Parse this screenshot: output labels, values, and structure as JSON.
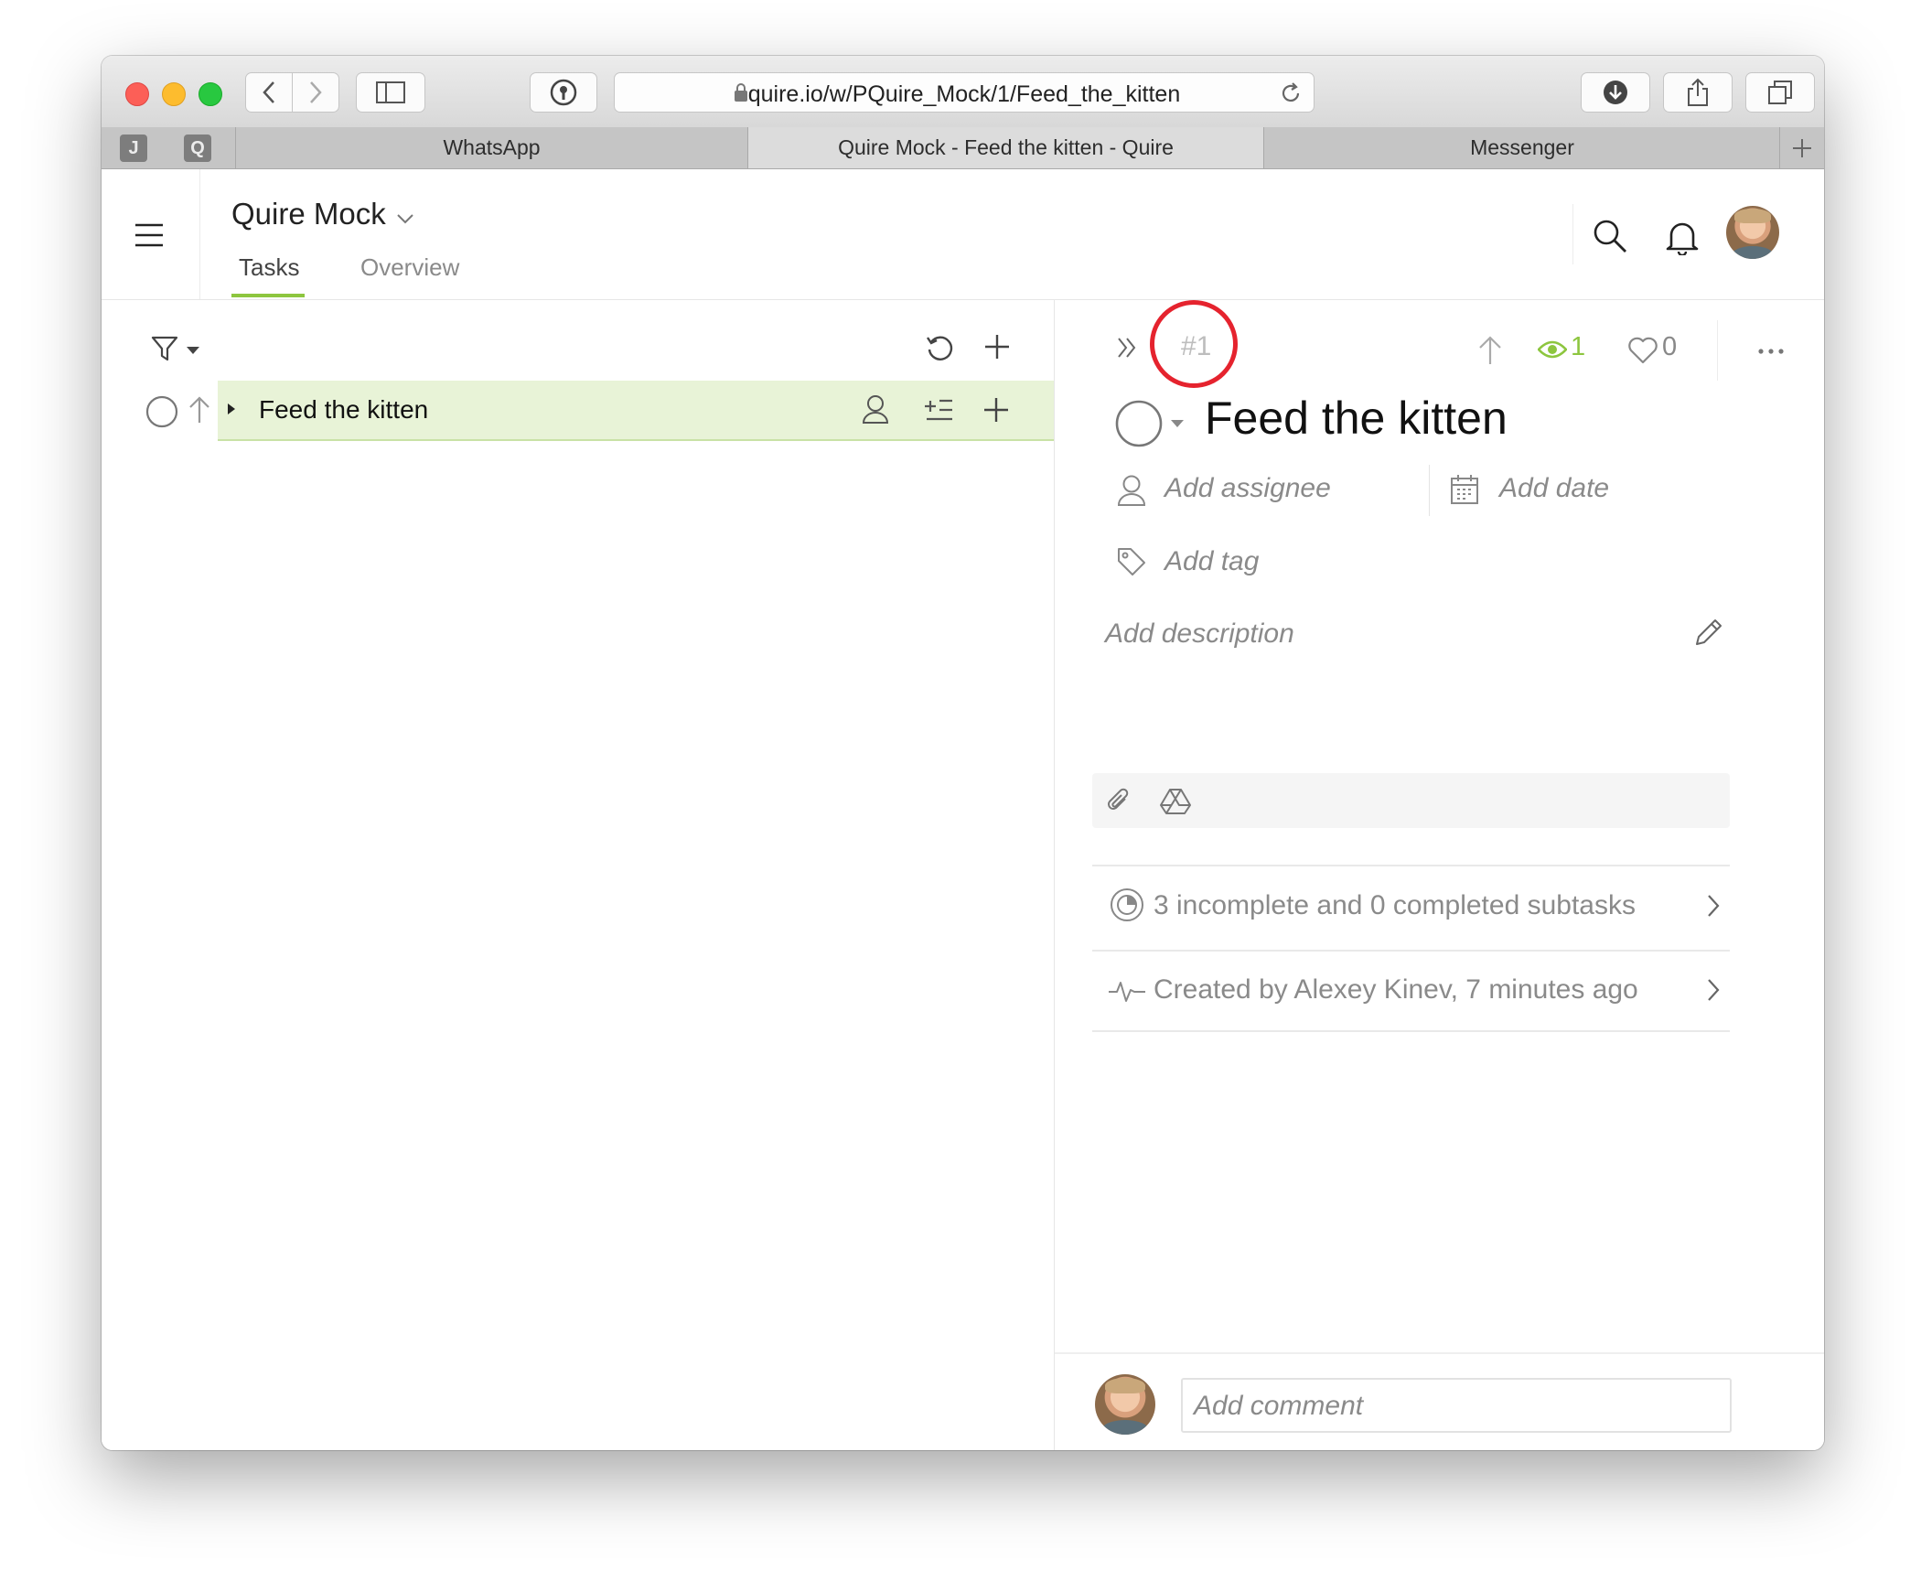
{
  "browser": {
    "url": "quire.io/w/PQuire_Mock/1/Feed_the_kitten",
    "pinned_tabs": [
      "J",
      "Q"
    ],
    "tabs": [
      {
        "label": "WhatsApp",
        "active": false
      },
      {
        "label": "Quire Mock - Feed the kitten - Quire",
        "active": true
      },
      {
        "label": "Messenger",
        "active": false
      }
    ]
  },
  "header": {
    "project_title": "Quire Mock",
    "tabs": [
      {
        "label": "Tasks",
        "active": true
      },
      {
        "label": "Overview",
        "active": false
      }
    ],
    "icons": [
      "menu-icon",
      "search-icon",
      "bell-icon",
      "avatar"
    ]
  },
  "task_list": {
    "tasks": [
      {
        "title": "Feed the kitten",
        "selected": true
      }
    ]
  },
  "detail": {
    "task_id": "#1",
    "watchers_count": "1",
    "likes_count": "0",
    "title": "Feed the kitten",
    "add_assignee": "Add assignee",
    "add_date": "Add date",
    "add_tag": "Add tag",
    "add_description": "Add description",
    "subtasks_summary": "3 incomplete and 0 completed subtasks",
    "activity_summary": "Created by Alexey Kinev, 7 minutes ago",
    "comment_placeholder": "Add comment"
  },
  "colors": {
    "accent_green": "#8dc63f",
    "selected_row_bg": "#e8f3d7",
    "highlight_ring": "#e5232e"
  }
}
